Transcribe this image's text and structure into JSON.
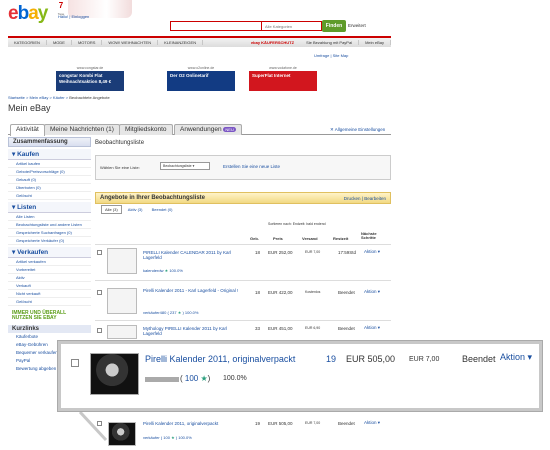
{
  "header": {
    "logo": {
      "e": "e",
      "b": "b",
      "a": "a",
      "y": "y"
    },
    "countdown_num": "7",
    "countdown_label": "Tage",
    "top_links": "Hallo! | Einloggen",
    "search_category": "Alle Kategorien",
    "search_button": "Finden",
    "advanced": "Erweitert",
    "categories": [
      "KATEGORIEN",
      "MODE",
      "MOTORS",
      "WOW! WEIHNACHTEN",
      "KLEINANZEIGEN"
    ],
    "kaeuferschutz": "ebay KÄUFERSCHUTZ",
    "paypal": "Sie Bezahlung mit PayPal",
    "mein_ebay": "Mein eBay",
    "small_links": "Umfrage  |  Site Map"
  },
  "ads": [
    {
      "caption": "www.congstar.de",
      "text": "congstar Kombi Flat Weihnachtsaktion 8,49 €"
    },
    {
      "caption": "www.o2online.de",
      "text": "Der O2 Onlinetarif"
    },
    {
      "caption": "www.vodafone.de",
      "text": "SuperFlat Internet"
    }
  ],
  "breadcrumb": {
    "links": "Startseite > Mein eBay > Käufer > ",
    "current": "Beobachtete Angebote"
  },
  "page_title": "Mein eBay",
  "tabs": [
    {
      "label": "Aktivität"
    },
    {
      "label": "Meine Nachrichten (1)"
    },
    {
      "label": "Mitgliedskonto"
    },
    {
      "label": "Anwendungen",
      "badge": "NEU"
    }
  ],
  "preferences_link": "Allgemeine Einstellungen",
  "sidebar": {
    "summary": "Zusammenfassung",
    "sections": [
      {
        "title": "Kaufen",
        "items": [
          "Artikel kaufen",
          "Gebote/Preisvorschläge (0)",
          "Gekauft (0)",
          "Überboten (0)",
          "Gelöscht"
        ]
      },
      {
        "title": "Listen",
        "items": [
          "Alle Listen",
          "Beobachtungsliste und andere Listen",
          "Gespeicherte Suchanfragen (0)",
          "Gespeicherte Verkäufer (0)"
        ]
      },
      {
        "title": "Verkaufen",
        "items": [
          "Artikel verkaufen",
          "Vorbereitet",
          "Aktiv",
          "Verkauft",
          "Nicht verkauft",
          "Gelöscht"
        ]
      }
    ],
    "immer": "IMMER UND ÜBERALL NUTZEN SIE EBAY",
    "kurzlinks_title": "Kurzlinks",
    "kurzlinks": [
      "Käuferbote",
      "eBay-Gebühren",
      "Bequemer verkaufen",
      "PayPal",
      "Bewertung abgeben"
    ]
  },
  "main": {
    "section_title": "Beobachtungsliste",
    "list_label": "Wählen Sie eine Liste:",
    "list_select": "Beobachtungsliste",
    "new_list": "Erstellen Sie eine neue Liste",
    "offers_title": "Angebote in Ihrer Beobachtungsliste",
    "print_edit": "Drucken | Bearbeiten",
    "subtabs": [
      "Alle (3)",
      "Aktiv (3)",
      "Beendet (0)"
    ],
    "sort": "Sortieren nach:    Endzeit: bald endend",
    "columns": [
      "Geb.",
      "Preis",
      "Versand",
      "Restzeit",
      "Nächste Schritte"
    ]
  },
  "rows": [
    {
      "title": "PIRELLI Kalender CALENDAR 2011 by Karl Lagerfeld",
      "seller": "kalenderdw",
      "score": "100.0%",
      "bids": "18",
      "price": "EUR 252,00",
      "ship": "EUR 7,00",
      "time": "17:59Std",
      "action": "Aktion"
    },
    {
      "title": "Pirelli Kalender 2011 - Karl Lagerfeld - Original !",
      "seller": "verkäufer480",
      "rating": "237",
      "score": "100.0%",
      "bids": "18",
      "price": "EUR 422,00",
      "ship": "Kostenlos",
      "time": "Beendet",
      "action": "Aktion"
    },
    {
      "title": "Mythology PIRELLI Kalender 2011 by Karl Lagerfeld",
      "seller": "",
      "score": "",
      "bids": "33",
      "price": "EUR 451,00",
      "ship": "EUR 6,90",
      "time": "Beendet",
      "action": "Aktion"
    },
    {
      "title": "Pirelli Kalender 2011, originalverpackt",
      "seller": "verkäufer",
      "rating": "100",
      "score": "100.0%",
      "bids": "19",
      "price": "EUR 505,00",
      "ship": "EUR 7,00",
      "time": "Beendet",
      "action": "Aktion"
    }
  ],
  "popup": {
    "title": "Pirelli Kalender 2011, originalverpackt",
    "rating": "100",
    "score": "100.0%",
    "bids": "19",
    "price": "EUR 505,00",
    "ship": "EUR 7,00",
    "status": "Beendet",
    "action": "Aktion"
  }
}
